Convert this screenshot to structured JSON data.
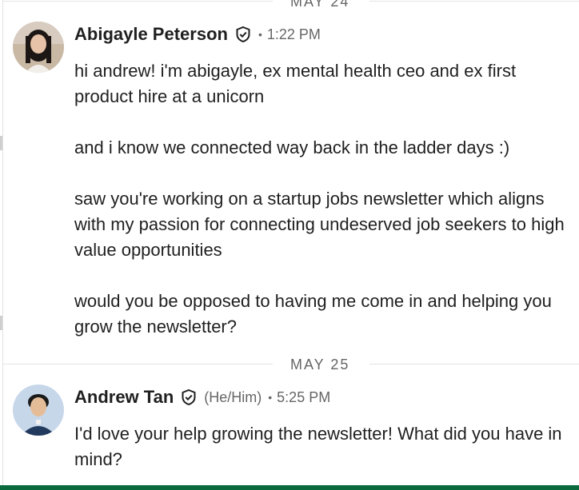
{
  "date_separators": [
    {
      "label": "MAY 24"
    },
    {
      "label": "MAY 25"
    }
  ],
  "messages": [
    {
      "sender": "Abigayle Peterson",
      "pronouns": "",
      "time": "1:22 PM",
      "paragraphs": [
        "hi andrew! i'm abigayle, ex mental health ceo and ex first product hire at a unicorn",
        "and i know we connected way back in the ladder days :)",
        "saw you're working on a startup jobs newsletter which aligns with my passion for connecting undeserved job seekers to high value opportunities",
        "would you be opposed to having me come in and helping you grow the newsletter?"
      ]
    },
    {
      "sender": "Andrew Tan",
      "pronouns": "(He/Him)",
      "time": "5:25 PM",
      "paragraphs": [
        "I'd love your help growing the newsletter! What did you have in mind?"
      ]
    }
  ],
  "separator_dot": "•",
  "colors": {
    "text": "#1f1f1f",
    "muted": "#666666",
    "divider": "#e3e3e3",
    "accent_bar": "#0a6a3e"
  },
  "icons": {
    "verified": "shield-check-icon"
  }
}
